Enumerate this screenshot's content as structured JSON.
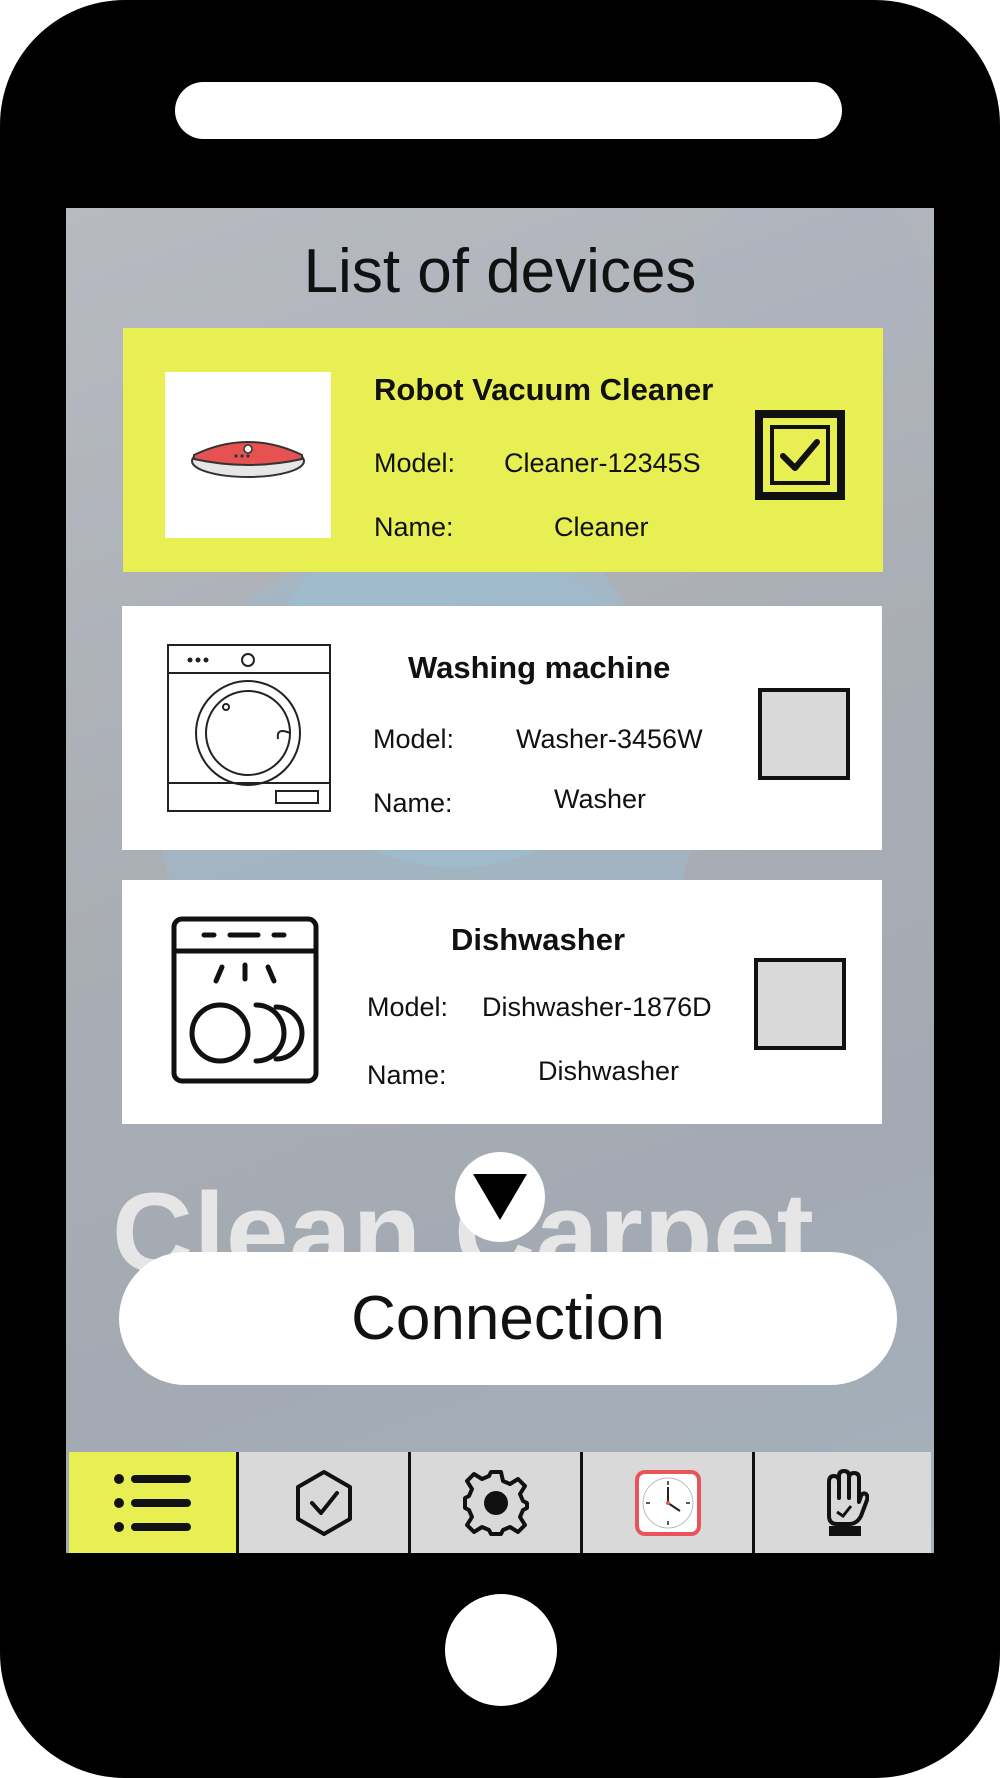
{
  "screen": {
    "title": "List of devices",
    "watermark": "Clean Carpet",
    "connect_label": "Connection"
  },
  "devices": [
    {
      "name": "Robot Vacuum Cleaner",
      "model_label": "Model:",
      "model": "Cleaner-12345S",
      "name_label": "Name:",
      "nickname": "Cleaner",
      "selected": true,
      "icon": "robot-vacuum-icon"
    },
    {
      "name": "Washing machine",
      "model_label": "Model:",
      "model": "Washer-3456W",
      "name_label": "Name:",
      "nickname": "Washer",
      "selected": false,
      "icon": "washing-machine-icon"
    },
    {
      "name": "Dishwasher",
      "model_label": "Model:",
      "model": "Dishwasher-1876D",
      "name_label": "Name:",
      "nickname": "Dishwasher",
      "selected": false,
      "icon": "dishwasher-icon"
    }
  ],
  "tabbar": {
    "tabs": [
      {
        "icon": "list-icon",
        "active": true
      },
      {
        "icon": "shield-check-icon",
        "active": false
      },
      {
        "icon": "gear-icon",
        "active": false
      },
      {
        "icon": "clock-icon",
        "active": false
      },
      {
        "icon": "hand-icon",
        "active": false
      }
    ]
  },
  "colors": {
    "accent": "#e8ef52",
    "card": "#ffffff",
    "phone": "#000000",
    "checkbox": "#d9d9d9",
    "clock_red": "#e8545a"
  }
}
